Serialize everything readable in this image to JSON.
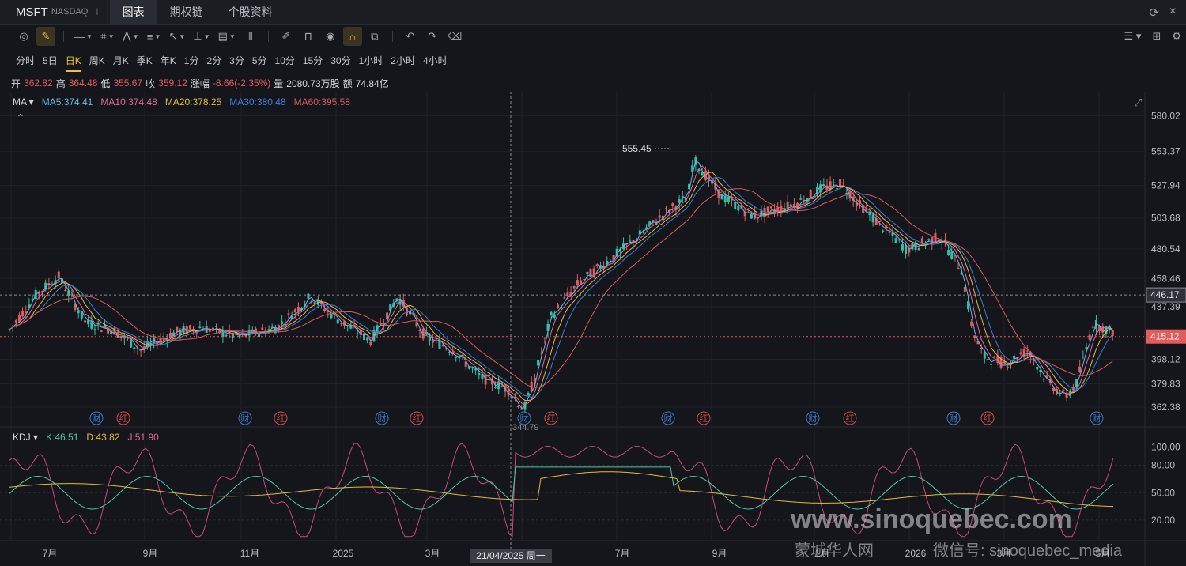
{
  "header": {
    "symbol": "MSFT",
    "exchange": "NASDAQ",
    "separator": "I",
    "tabs": [
      {
        "label": "图表",
        "active": true
      },
      {
        "label": "期权链",
        "active": false
      },
      {
        "label": "个股资料",
        "active": false
      }
    ]
  },
  "toolbar": {
    "icons": [
      "settings-icon",
      "draw-icon",
      "line-tool-icon",
      "rect-tool-icon",
      "pattern-tool-icon",
      "fib-tool-icon",
      "arrow-tool-icon",
      "measure-tool-icon",
      "text-tool-icon",
      "indicator-icon",
      "pen-icon",
      "lock-icon",
      "eye-icon",
      "magnet-icon",
      "link-icon",
      "undo-icon",
      "redo-icon",
      "trash-icon"
    ],
    "right_icons": [
      "layout-icon",
      "grid-icon",
      "gear-icon"
    ]
  },
  "periods": [
    {
      "label": "分时"
    },
    {
      "label": "5日"
    },
    {
      "label": "日K",
      "active": true
    },
    {
      "label": "周K"
    },
    {
      "label": "月K"
    },
    {
      "label": "季K"
    },
    {
      "label": "年K"
    },
    {
      "label": "1分"
    },
    {
      "label": "2分"
    },
    {
      "label": "3分"
    },
    {
      "label": "5分"
    },
    {
      "label": "10分"
    },
    {
      "label": "15分"
    },
    {
      "label": "30分"
    },
    {
      "label": "1小时"
    },
    {
      "label": "2小时"
    },
    {
      "label": "4小时"
    }
  ],
  "quote": {
    "open_label": "开",
    "open": "362.82",
    "high_label": "高",
    "high": "364.48",
    "low_label": "低",
    "low": "355.67",
    "close_label": "收",
    "close": "359.12",
    "change_label": "涨幅",
    "change": "-8.66(-2.35%)",
    "volume_label": "量",
    "volume": "2080.73万股",
    "amount_label": "额",
    "amount": "74.84亿"
  },
  "ma_legend": {
    "name": "MA",
    "items": [
      {
        "text": "MA5:374.41",
        "color": "#62b6e6"
      },
      {
        "text": "MA10:374.48",
        "color": "#e3689a"
      },
      {
        "text": "MA20:378.25",
        "color": "#e3b945"
      },
      {
        "text": "MA30:380.48",
        "color": "#3a7fd6"
      },
      {
        "text": "MA60:395.58",
        "color": "#d45a5a"
      }
    ]
  },
  "kdj_legend": {
    "name": "KDJ",
    "items": [
      {
        "text": "K:46.51",
        "color": "#4fc6a8"
      },
      {
        "text": "D:43.82",
        "color": "#e3b945"
      },
      {
        "text": "J:51.90",
        "color": "#e3689a"
      }
    ]
  },
  "price_axis": [
    "580.02",
    "553.37",
    "527.94",
    "503.68",
    "480.54",
    "458.46",
    "437.39",
    "398.12",
    "379.83",
    "362.38"
  ],
  "price_tags": {
    "current": "415.12",
    "crosshair": "446.17"
  },
  "peak_label": "555.45",
  "low_label": "344.79",
  "kdj_axis": [
    "100.00",
    "80.00",
    "50.00",
    "20.00"
  ],
  "time_axis": [
    "7月",
    "9月",
    "11月",
    "2025",
    "3月",
    "7月",
    "9月",
    "1月",
    "2026",
    "3月",
    "5月"
  ],
  "crosshair_date": "21/04/2025 周一",
  "events": [
    {
      "label": "财",
      "kind": "earnings"
    },
    {
      "label": "红",
      "kind": "dividend"
    }
  ],
  "watermark": {
    "line1": "www.sinoquebec.com",
    "line2": "蒙城华人网",
    "line3": "微信号: sinoquebec_media"
  },
  "colors": {
    "up": "#2fc1a4",
    "down": "#e35b5b",
    "background": "#15161b",
    "accent": "#e9c13f"
  },
  "chart_data": {
    "type": "candlestick",
    "series": [
      {
        "name": "MA5",
        "color": "#62b6e6"
      },
      {
        "name": "MA10",
        "color": "#e3689a"
      },
      {
        "name": "MA20",
        "color": "#e3b945"
      },
      {
        "name": "MA30",
        "color": "#3a7fd6"
      },
      {
        "name": "MA60",
        "color": "#d45a5a"
      }
    ],
    "price_keypoints": [
      [
        0,
        420
      ],
      [
        25,
        447
      ],
      [
        45,
        460
      ],
      [
        70,
        425
      ],
      [
        95,
        420
      ],
      [
        120,
        405
      ],
      [
        150,
        418
      ],
      [
        175,
        422
      ],
      [
        210,
        415
      ],
      [
        245,
        422
      ],
      [
        275,
        445
      ],
      [
        300,
        428
      ],
      [
        330,
        412
      ],
      [
        355,
        445
      ],
      [
        380,
        415
      ],
      [
        405,
        405
      ],
      [
        430,
        385
      ],
      [
        455,
        376
      ],
      [
        470,
        360
      ],
      [
        480,
        385
      ],
      [
        495,
        430
      ],
      [
        520,
        455
      ],
      [
        560,
        480
      ],
      [
        600,
        508
      ],
      [
        620,
        520
      ],
      [
        625,
        548
      ],
      [
        650,
        520
      ],
      [
        680,
        505
      ],
      [
        720,
        515
      ],
      [
        740,
        525
      ],
      [
        760,
        530
      ],
      [
        775,
        515
      ],
      [
        800,
        495
      ],
      [
        820,
        480
      ],
      [
        850,
        490
      ],
      [
        870,
        465
      ],
      [
        880,
        420
      ],
      [
        890,
        400
      ],
      [
        910,
        395
      ],
      [
        930,
        405
      ],
      [
        950,
        380
      ],
      [
        965,
        370
      ],
      [
        975,
        380
      ],
      [
        990,
        425
      ],
      [
        1010,
        418
      ]
    ],
    "ylim": [
      350,
      585
    ],
    "kdj_ylim": [
      0,
      110
    ]
  }
}
